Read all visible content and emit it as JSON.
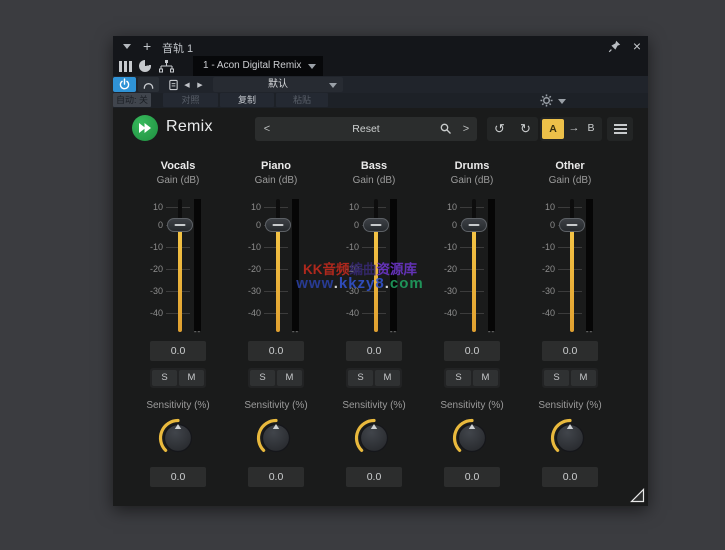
{
  "titlebar": {
    "track_name": "音轨 1",
    "plus_glyph": "+",
    "close_glyph": "×"
  },
  "tabrow": {
    "tab_label": "1 - Acon Digital Remix"
  },
  "toolbar": {
    "preset_name": "默认",
    "prev_glyph": "◀",
    "next_glyph": "▶",
    "auto_label": "自动: 关",
    "compare_label": "对照",
    "copy_label": "复制",
    "paste_label": "粘贴"
  },
  "header": {
    "plugin_name": "Remix",
    "preset_value": "Reset",
    "left_chevron": "<",
    "right_chevron": ">",
    "undo_glyph": "↺",
    "redo_glyph": "↻",
    "ab_a": "A",
    "ab_arrow": "→",
    "ab_b": "B"
  },
  "fader_scale": [
    "10",
    "0",
    "-10",
    "-20",
    "-30",
    "-40"
  ],
  "channels": [
    {
      "name": "Vocals",
      "param_label": "Gain (dB)",
      "gain_value": "0.0",
      "solo_label": "S",
      "mute_label": "M",
      "sensitivity_label": "Sensitivity (%)",
      "sensitivity_value": "0.0",
      "meter_peak": "--"
    },
    {
      "name": "Piano",
      "param_label": "Gain (dB)",
      "gain_value": "0.0",
      "solo_label": "S",
      "mute_label": "M",
      "sensitivity_label": "Sensitivity (%)",
      "sensitivity_value": "0.0",
      "meter_peak": "--"
    },
    {
      "name": "Bass",
      "param_label": "Gain (dB)",
      "gain_value": "0.0",
      "solo_label": "S",
      "mute_label": "M",
      "sensitivity_label": "Sensitivity (%)",
      "sensitivity_value": "0.0",
      "meter_peak": "--"
    },
    {
      "name": "Drums",
      "param_label": "Gain (dB)",
      "gain_value": "0.0",
      "solo_label": "S",
      "mute_label": "M",
      "sensitivity_label": "Sensitivity (%)",
      "sensitivity_value": "0.0",
      "meter_peak": "--"
    },
    {
      "name": "Other",
      "param_label": "Gain (dB)",
      "gain_value": "0.0",
      "solo_label": "S",
      "mute_label": "M",
      "sensitivity_label": "Sensitivity (%)",
      "sensitivity_value": "0.0",
      "meter_peak": "--"
    }
  ],
  "watermark": {
    "line1": [
      {
        "text": "KK音频",
        "color": "#c02a1e"
      },
      {
        "text": "编曲",
        "color": "#35286e"
      },
      {
        "text": "资源库",
        "color": "#6c35c8"
      }
    ],
    "line2": [
      {
        "text": "www",
        "color": "#2a3fa0"
      },
      {
        "text": ".",
        "color": "#e8e8e8"
      },
      {
        "text": "kkzy8",
        "color": "#3252cc"
      },
      {
        "text": ".",
        "color": "#e8e8e8"
      },
      {
        "text": "com",
        "color": "#20a060"
      }
    ]
  },
  "colors": {
    "accent_yellow": "#e9b93d",
    "power_blue": "#2f93d6",
    "logo_green": "#2aa04d",
    "ab_active_yellow": "#ecc049"
  }
}
